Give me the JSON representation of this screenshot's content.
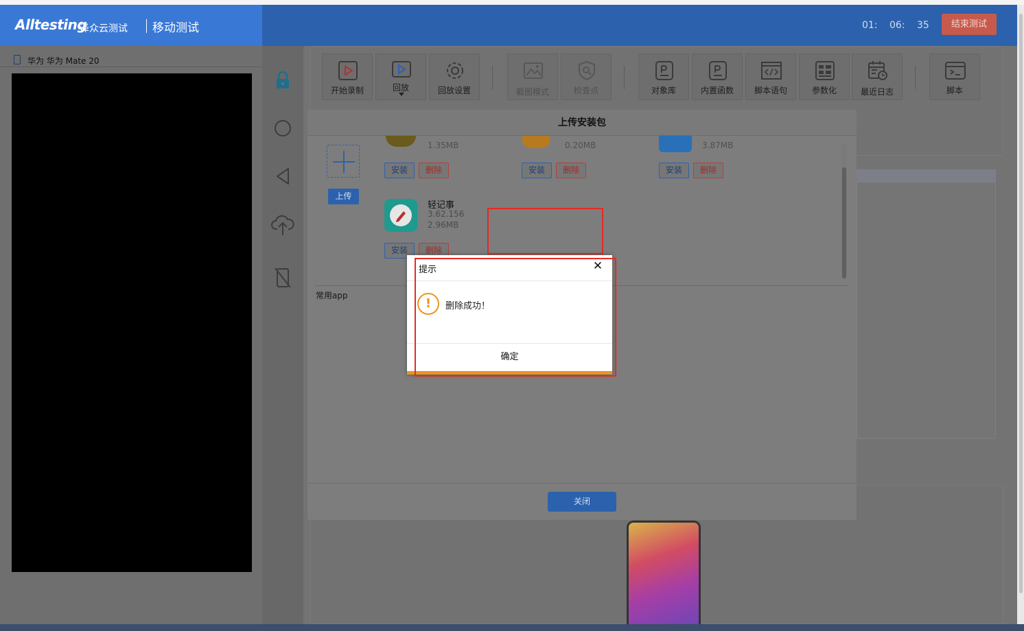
{
  "header": {
    "brand": "Alltesting",
    "brand_cn": "泽众云测试",
    "module": "移动测试",
    "timer": {
      "hours": "01:",
      "minutes": "06:",
      "seconds": "35"
    },
    "end_button": "结束测试"
  },
  "device": {
    "name": "华为 华为 Mate 20"
  },
  "toolbar": {
    "buttons": [
      {
        "label": "开始录制",
        "icon": "play-record-icon"
      },
      {
        "label": "回放",
        "icon": "playback-icon"
      },
      {
        "label": "回放设置",
        "icon": "gear-icon"
      },
      {
        "label": "截图模式",
        "icon": "image-icon"
      },
      {
        "label": "检查点",
        "icon": "shield-search-icon"
      },
      {
        "label": "对象库",
        "icon": "object-library-icon"
      },
      {
        "label": "内置函数",
        "icon": "function-icon"
      },
      {
        "label": "脚本语句",
        "icon": "code-window-icon"
      },
      {
        "label": "参数化",
        "icon": "table-icon"
      },
      {
        "label": "最近日志",
        "icon": "calendar-clock-icon"
      },
      {
        "label": "脚本",
        "icon": "terminal-icon"
      }
    ]
  },
  "upload_dialog": {
    "title": "上传安装包",
    "upload_button": "上传",
    "top_apps": [
      {
        "size": "1.35MB",
        "install": "安装",
        "delete": "删除"
      },
      {
        "size": "0.20MB",
        "install": "安装",
        "delete": "删除"
      },
      {
        "size": "3.87MB",
        "install": "安装",
        "delete": "删除"
      }
    ],
    "app": {
      "name": "轻记事",
      "version": "3.62.156",
      "size": "2.96MB",
      "install": "安装",
      "delete": "删除"
    },
    "common_apps_label": "常用app",
    "close_button": "关闭"
  },
  "alert": {
    "title": "提示",
    "close": "✕",
    "icon": "!",
    "message": "删除成功！",
    "ok_button": "确定"
  },
  "colors": {
    "header_bg": "#2c62ad",
    "logo_bg": "#3a78d6",
    "end_button": "#c75a4c",
    "primary_blue": "#2c62ad",
    "warning_orange": "#f1931b",
    "annotation_red": "#e42a22"
  }
}
